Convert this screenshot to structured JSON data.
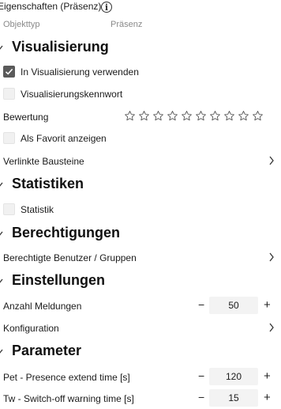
{
  "header": {
    "title": "Eigenschaften (Präsenz)",
    "info_icon": "info-icon"
  },
  "object_type": {
    "label": "Objekttyp",
    "value": "Präsenz"
  },
  "sections": {
    "visualisierung": {
      "title": "Visualisierung",
      "use_in_visualization": {
        "label": "In Visualisierung verwenden",
        "checked": true
      },
      "visualization_password": {
        "label": "Visualisierungskennwort",
        "checked": false
      },
      "rating": {
        "label": "Bewertung",
        "stars_total": 10,
        "stars_filled": 0
      },
      "show_favorite": {
        "label": "Als Favorit anzeigen",
        "checked": false
      },
      "linked_blocks": {
        "label": "Verlinkte Bausteine"
      }
    },
    "statistiken": {
      "title": "Statistiken",
      "statistik": {
        "label": "Statistik",
        "checked": false
      }
    },
    "berechtigungen": {
      "title": "Berechtigungen",
      "authorized_users": {
        "label": "Berechtigte Benutzer / Gruppen"
      }
    },
    "einstellungen": {
      "title": "Einstellungen",
      "message_count": {
        "label": "Anzahl Meldungen",
        "value": "50",
        "minus": "−",
        "plus": "+"
      },
      "configuration": {
        "label": "Konfiguration"
      }
    },
    "parameter": {
      "title": "Parameter",
      "pet": {
        "label": "Pet - Presence extend time [s]",
        "value": "120",
        "minus": "−",
        "plus": "+"
      },
      "tw": {
        "label": "Tw - Switch-off warning time [s]",
        "value": "15",
        "minus": "−",
        "plus": "+"
      }
    }
  }
}
